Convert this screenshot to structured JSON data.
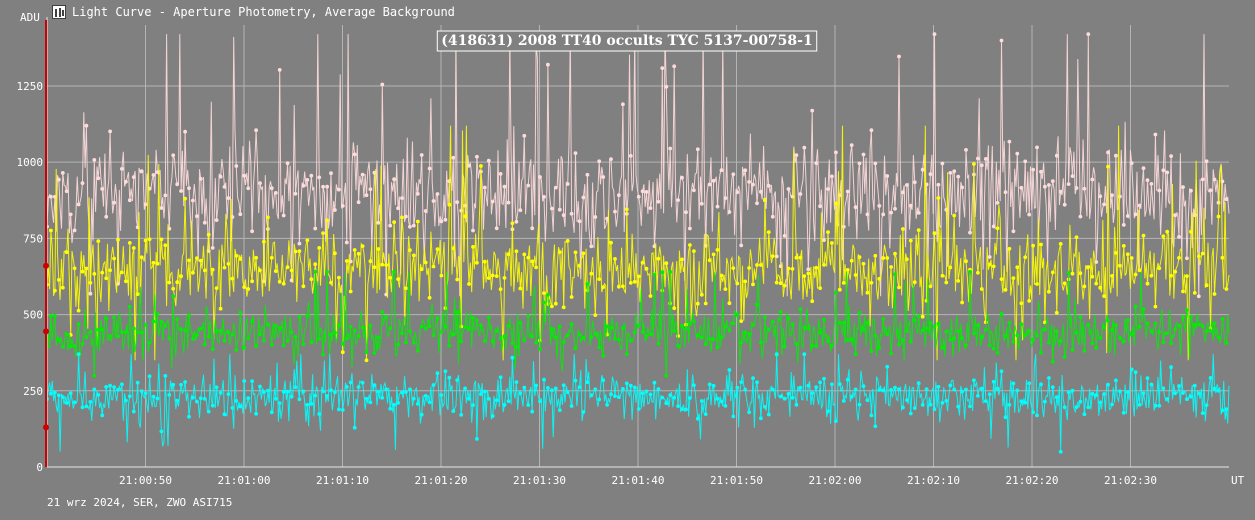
{
  "window": {
    "title": "Light Curve - Aperture Photometry, Average Background",
    "icon": "light-curve-app-icon"
  },
  "footer": {
    "info": "21 wrz 2024, SER, ZWO ASI715"
  },
  "colors": {
    "background": "#808080",
    "grid": "#b4b4b4",
    "axis": "#e6e6e6",
    "cursor": "#cc0000",
    "series_pink": "#ffdcdc",
    "series_yellow": "#ffff00",
    "series_green": "#00ee00",
    "series_cyan": "#00ffff"
  },
  "chart_data": {
    "type": "line",
    "title": "(418631) 2008 TT40 occults TYC 5137-00758-1",
    "ylabel": "ADU",
    "xlabel": "UT",
    "ylim": [
      0,
      1450
    ],
    "yticks": [
      0,
      250,
      500,
      750,
      1000,
      1250
    ],
    "ytick_labels": [
      "0",
      "250",
      "500",
      "750",
      "1000",
      "1250"
    ],
    "xlim": [
      "21:00:40",
      "21:02:40"
    ],
    "xticks": [
      "21:00:50",
      "21:01:00",
      "21:01:10",
      "21:01:20",
      "21:01:30",
      "21:01:40",
      "21:01:50",
      "21:02:00",
      "21:02:10",
      "21:02:20",
      "21:02:30"
    ],
    "grid": true,
    "legend": "none",
    "cursor_x": "21:00:40",
    "cursor_values": [
      660,
      445,
      130
    ],
    "series": [
      {
        "color": "#ffdcdc",
        "mean": 900,
        "sd": 130,
        "min": 560,
        "max": 1420
      },
      {
        "color": "#ffff00",
        "mean": 650,
        "sd": 110,
        "min": 350,
        "max": 1120
      },
      {
        "color": "#00ee00",
        "mean": 440,
        "sd": 60,
        "min": 300,
        "max": 640
      },
      {
        "color": "#00ffff",
        "mean": 230,
        "sd": 55,
        "min": 50,
        "max": 370
      }
    ]
  }
}
